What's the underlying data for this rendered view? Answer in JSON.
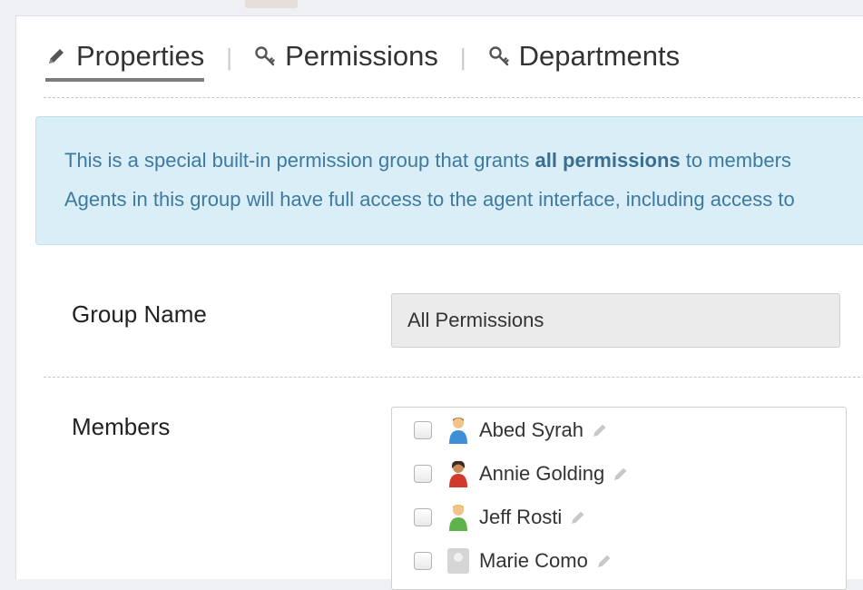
{
  "tabs": [
    {
      "label": "Properties",
      "icon": "pencil-icon",
      "active": true
    },
    {
      "label": "Permissions",
      "icon": "key-icon",
      "active": false
    },
    {
      "label": "Departments",
      "icon": "key-icon",
      "active": false
    }
  ],
  "tab_separator": "|",
  "notice": {
    "line1_pre": "This is a special built-in permission group that grants ",
    "line1_bold": "all permissions",
    "line1_post": " to members",
    "line2": "Agents in this group will have full access to the agent interface, including access to"
  },
  "form": {
    "group_name_label": "Group Name",
    "group_name_value": "All Permissions",
    "members_label": "Members"
  },
  "members": [
    {
      "name": "Abed Syrah",
      "avatar": "agent-avatar-blue",
      "checked": false
    },
    {
      "name": "Annie Golding",
      "avatar": "agent-avatar-red",
      "checked": false
    },
    {
      "name": "Jeff Rosti",
      "avatar": "agent-avatar-green",
      "checked": false
    },
    {
      "name": "Marie Como",
      "avatar": "agent-avatar-gray",
      "checked": false
    }
  ]
}
